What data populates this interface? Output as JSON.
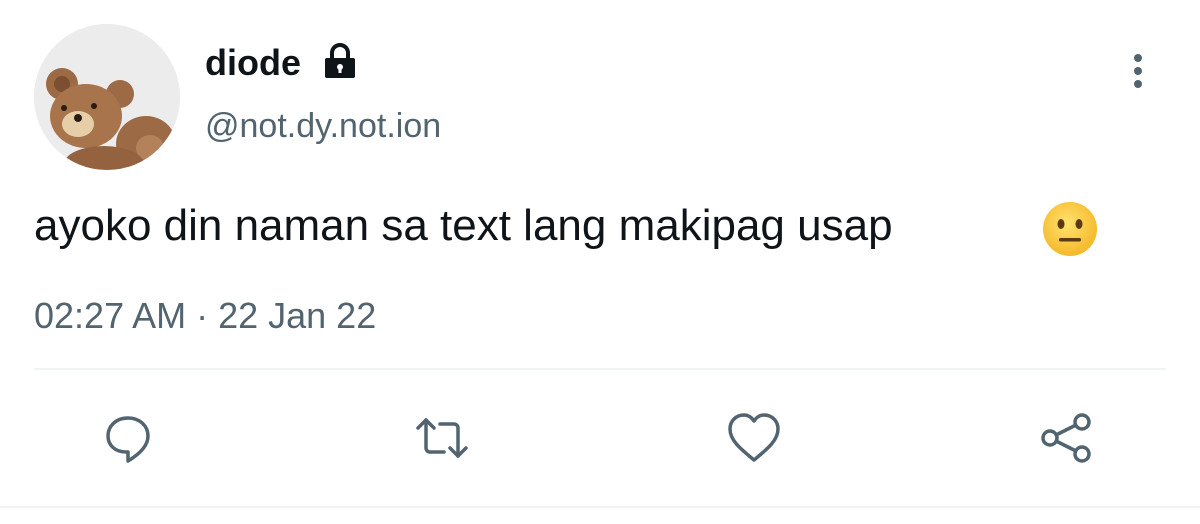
{
  "user": {
    "display_name": "diode",
    "handle": "@not.dy.not.ion",
    "protected": true,
    "avatar": "teddy-bear-photo"
  },
  "tweet": {
    "text": "ayoko din naman sa text lang makipag usap",
    "emoji": "neutral-face",
    "timestamp": "02:27 AM · 22 Jan 22"
  },
  "actions": [
    {
      "name": "reply",
      "icon": "speech-bubble-icon"
    },
    {
      "name": "retweet",
      "icon": "retweet-icon"
    },
    {
      "name": "like",
      "icon": "heart-icon"
    },
    {
      "name": "share",
      "icon": "share-icon"
    }
  ],
  "colors": {
    "text_primary": "#0f1419",
    "text_secondary": "#536471",
    "divider": "#eff3f4"
  }
}
